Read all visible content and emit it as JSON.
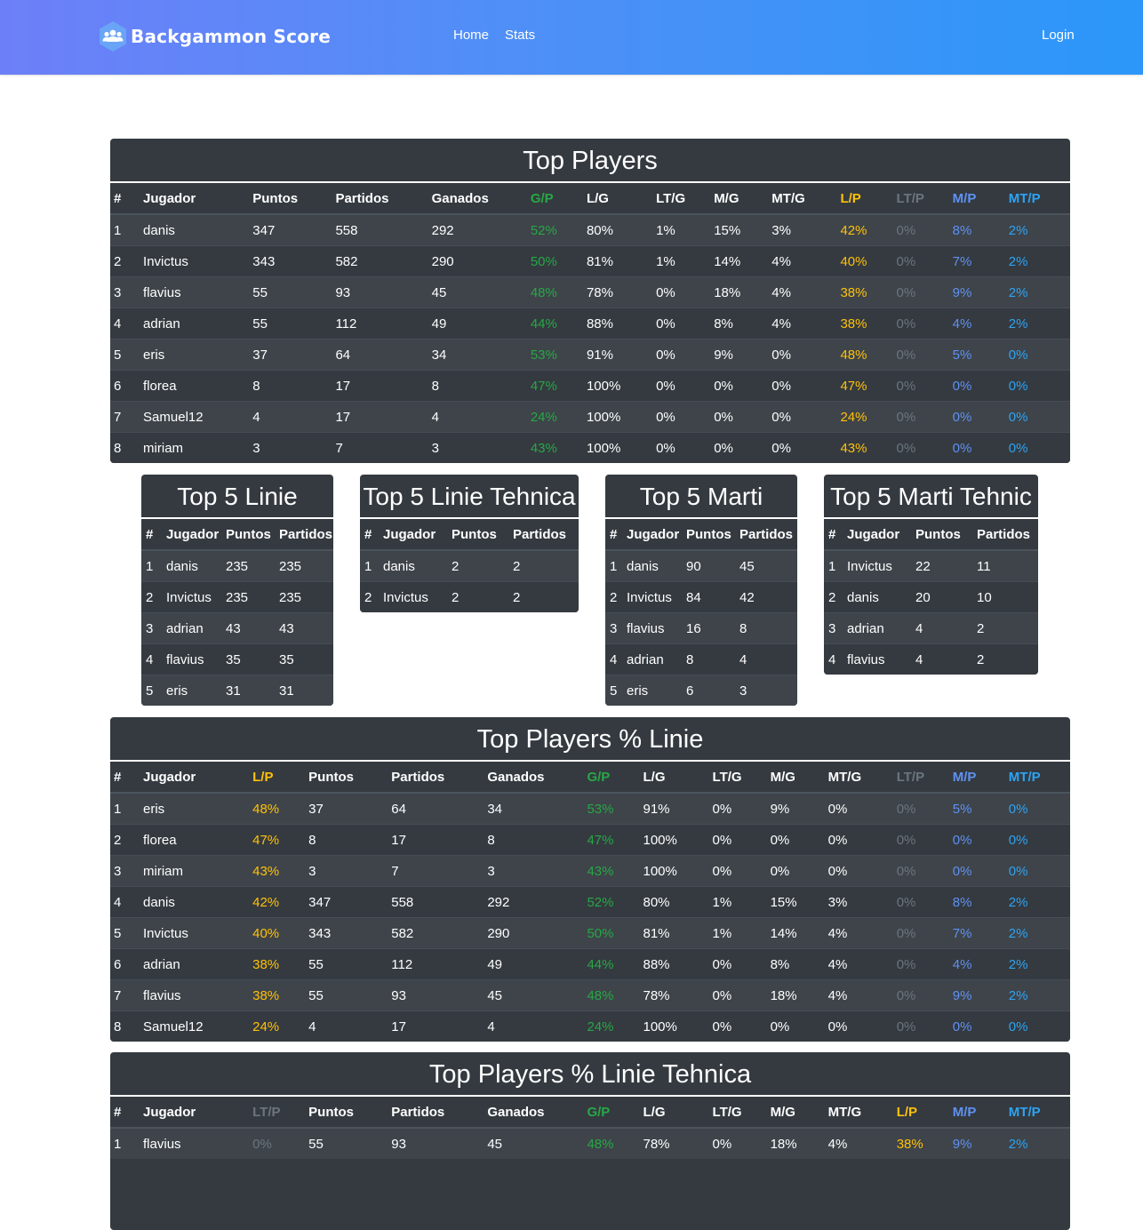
{
  "brand": {
    "name": "Backgammon Score",
    "icon": "users-icon"
  },
  "nav": {
    "home": "Home",
    "stats": "Stats",
    "login": "Login"
  },
  "colors": {
    "green": "#28a745",
    "yellow": "#ffc107",
    "gray": "#6c757d",
    "blue": "#5f91f2",
    "cyan": "#2ea3f2",
    "card_bg": "#343a40"
  },
  "top_players": {
    "title": "Top Players",
    "columns": [
      "#",
      "Jugador",
      "Puntos",
      "Partidos",
      "Ganados",
      "G/P",
      "L/G",
      "LT/G",
      "M/G",
      "MT/G",
      "L/P",
      "LT/P",
      "M/P",
      "MT/P"
    ],
    "column_colors": [
      "",
      "",
      "",
      "",
      "",
      "green",
      "",
      "",
      "",
      "",
      "yellow",
      "gray",
      "blue",
      "cyan"
    ],
    "rows": [
      [
        "1",
        "danis",
        "347",
        "558",
        "292",
        "52%",
        "80%",
        "1%",
        "15%",
        "3%",
        "42%",
        "0%",
        "8%",
        "2%"
      ],
      [
        "2",
        "Invictus",
        "343",
        "582",
        "290",
        "50%",
        "81%",
        "1%",
        "14%",
        "4%",
        "40%",
        "0%",
        "7%",
        "2%"
      ],
      [
        "3",
        "flavius",
        "55",
        "93",
        "45",
        "48%",
        "78%",
        "0%",
        "18%",
        "4%",
        "38%",
        "0%",
        "9%",
        "2%"
      ],
      [
        "4",
        "adrian",
        "55",
        "112",
        "49",
        "44%",
        "88%",
        "0%",
        "8%",
        "4%",
        "38%",
        "0%",
        "4%",
        "2%"
      ],
      [
        "5",
        "eris",
        "37",
        "64",
        "34",
        "53%",
        "91%",
        "0%",
        "9%",
        "0%",
        "48%",
        "0%",
        "5%",
        "0%"
      ],
      [
        "6",
        "florea",
        "8",
        "17",
        "8",
        "47%",
        "100%",
        "0%",
        "0%",
        "0%",
        "47%",
        "0%",
        "0%",
        "0%"
      ],
      [
        "7",
        "Samuel12",
        "4",
        "17",
        "4",
        "24%",
        "100%",
        "0%",
        "0%",
        "0%",
        "24%",
        "0%",
        "0%",
        "0%"
      ],
      [
        "8",
        "miriam",
        "3",
        "7",
        "3",
        "43%",
        "100%",
        "0%",
        "0%",
        "0%",
        "43%",
        "0%",
        "0%",
        "0%"
      ]
    ]
  },
  "top5_linie": {
    "title": "Top 5 Linie",
    "columns": [
      "#",
      "Jugador",
      "Puntos",
      "Partidos"
    ],
    "rows": [
      [
        "1",
        "danis",
        "235",
        "235"
      ],
      [
        "2",
        "Invictus",
        "235",
        "235"
      ],
      [
        "3",
        "adrian",
        "43",
        "43"
      ],
      [
        "4",
        "flavius",
        "35",
        "35"
      ],
      [
        "5",
        "eris",
        "31",
        "31"
      ]
    ]
  },
  "top5_linie_tehnica": {
    "title": "Top 5 Linie Tehnica",
    "columns": [
      "#",
      "Jugador",
      "Puntos",
      "Partidos"
    ],
    "rows": [
      [
        "1",
        "danis",
        "2",
        "2"
      ],
      [
        "2",
        "Invictus",
        "2",
        "2"
      ]
    ]
  },
  "top5_marti": {
    "title": "Top 5 Marti",
    "columns": [
      "#",
      "Jugador",
      "Puntos",
      "Partidos"
    ],
    "rows": [
      [
        "1",
        "danis",
        "90",
        "45"
      ],
      [
        "2",
        "Invictus",
        "84",
        "42"
      ],
      [
        "3",
        "flavius",
        "16",
        "8"
      ],
      [
        "4",
        "adrian",
        "8",
        "4"
      ],
      [
        "5",
        "eris",
        "6",
        "3"
      ]
    ]
  },
  "top5_marti_tehnic": {
    "title": "Top 5 Marti Tehnic",
    "columns": [
      "#",
      "Jugador",
      "Puntos",
      "Partidos"
    ],
    "rows": [
      [
        "1",
        "Invictus",
        "22",
        "11"
      ],
      [
        "2",
        "danis",
        "20",
        "10"
      ],
      [
        "3",
        "adrian",
        "4",
        "2"
      ],
      [
        "4",
        "flavius",
        "4",
        "2"
      ]
    ]
  },
  "top_players_linie": {
    "title": "Top Players % Linie",
    "columns": [
      "#",
      "Jugador",
      "L/P",
      "Puntos",
      "Partidos",
      "Ganados",
      "G/P",
      "L/G",
      "LT/G",
      "M/G",
      "MT/G",
      "LT/P",
      "M/P",
      "MT/P"
    ],
    "column_colors": [
      "",
      "",
      "yellow",
      "",
      "",
      "",
      "green",
      "",
      "",
      "",
      "",
      "gray",
      "blue",
      "cyan"
    ],
    "rows": [
      [
        "1",
        "eris",
        "48%",
        "37",
        "64",
        "34",
        "53%",
        "91%",
        "0%",
        "9%",
        "0%",
        "0%",
        "5%",
        "0%"
      ],
      [
        "2",
        "florea",
        "47%",
        "8",
        "17",
        "8",
        "47%",
        "100%",
        "0%",
        "0%",
        "0%",
        "0%",
        "0%",
        "0%"
      ],
      [
        "3",
        "miriam",
        "43%",
        "3",
        "7",
        "3",
        "43%",
        "100%",
        "0%",
        "0%",
        "0%",
        "0%",
        "0%",
        "0%"
      ],
      [
        "4",
        "danis",
        "42%",
        "347",
        "558",
        "292",
        "52%",
        "80%",
        "1%",
        "15%",
        "3%",
        "0%",
        "8%",
        "2%"
      ],
      [
        "5",
        "Invictus",
        "40%",
        "343",
        "582",
        "290",
        "50%",
        "81%",
        "1%",
        "14%",
        "4%",
        "0%",
        "7%",
        "2%"
      ],
      [
        "6",
        "adrian",
        "38%",
        "55",
        "112",
        "49",
        "44%",
        "88%",
        "0%",
        "8%",
        "4%",
        "0%",
        "4%",
        "2%"
      ],
      [
        "7",
        "flavius",
        "38%",
        "55",
        "93",
        "45",
        "48%",
        "78%",
        "0%",
        "18%",
        "4%",
        "0%",
        "9%",
        "2%"
      ],
      [
        "8",
        "Samuel12",
        "24%",
        "4",
        "17",
        "4",
        "24%",
        "100%",
        "0%",
        "0%",
        "0%",
        "0%",
        "0%",
        "0%"
      ]
    ]
  },
  "top_players_linie_tehnica": {
    "title": "Top Players % Linie Tehnica",
    "columns": [
      "#",
      "Jugador",
      "LT/P",
      "Puntos",
      "Partidos",
      "Ganados",
      "G/P",
      "L/G",
      "LT/G",
      "M/G",
      "MT/G",
      "L/P",
      "M/P",
      "MT/P"
    ],
    "column_colors": [
      "",
      "",
      "gray",
      "",
      "",
      "",
      "green",
      "",
      "",
      "",
      "",
      "yellow",
      "blue",
      "cyan"
    ],
    "rows": [
      [
        "1",
        "flavius",
        "0%",
        "55",
        "93",
        "45",
        "48%",
        "78%",
        "0%",
        "18%",
        "4%",
        "38%",
        "9%",
        "2%"
      ]
    ]
  }
}
